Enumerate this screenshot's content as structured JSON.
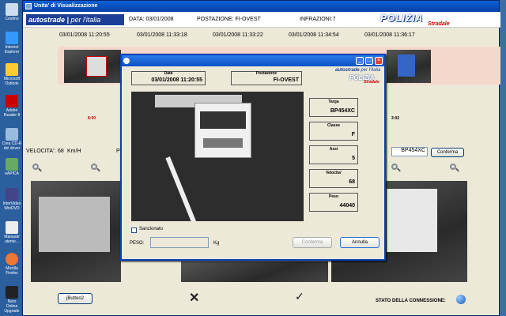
{
  "desktop": {
    "icons": [
      "Cestino",
      "Internet Explorer",
      "Microsoft Outlook",
      "Adobe Reader 8",
      "Crea CD-R dei driver",
      "eAPICA",
      "InterVideo WinDVD",
      "Manuale utente...",
      "Mozilla Firefox",
      "Nero Online Upgrade"
    ]
  },
  "window": {
    "title": "Unita' di Visualizzazione"
  },
  "header": {
    "logo_main": "autostrade",
    "logo_sub": "per l'italia",
    "data": "DATA: 03/01/2008",
    "postazione": "POSTAZIONE: FI-OVEST",
    "infrazioni": "INFRAZIONI:7",
    "police": "POLIZIA",
    "police_sub": "Stradale"
  },
  "timestamps": [
    "03/01/2008 11:20:55",
    "03/01/2008 11:33:18",
    "03/01/2008 11:33:22",
    "03/01/2008 11:34:54",
    "03/01/2008 11:36:17"
  ],
  "thumb_labels": [
    "8:00",
    "3:02"
  ],
  "velocita": {
    "label": "VELOCITA':",
    "value": "68",
    "unit": "Km/H",
    "p_label": "P"
  },
  "targa_main": {
    "value": "BP454XC",
    "confirm": "Conferma"
  },
  "bottom": {
    "jbutton": "jButton2",
    "stato": "STATO DELLA CONNESSIONE:"
  },
  "dialog": {
    "data_label": "Data",
    "data_value": "03/01/2008 11:20:55",
    "postazione_label": "Postazione",
    "postazione_value": "FI-OVEST",
    "logo_main": "autostrade",
    "logo_sub": "per l'italia",
    "police": "POLIZIA",
    "police_sub": "Stradale",
    "fields": [
      {
        "label": "Targa",
        "value": "BP454XC"
      },
      {
        "label": "Classe",
        "value": "F"
      },
      {
        "label": "Assi",
        "value": "5"
      },
      {
        "label": "Velocita'",
        "value": "68"
      },
      {
        "label": "Peso",
        "value": "44040"
      }
    ],
    "sanzionato": "Sanzionato",
    "peso_label": "PESO:",
    "peso_unit": "Kg",
    "confirm": "Conferma",
    "cancel": "Annulla"
  }
}
